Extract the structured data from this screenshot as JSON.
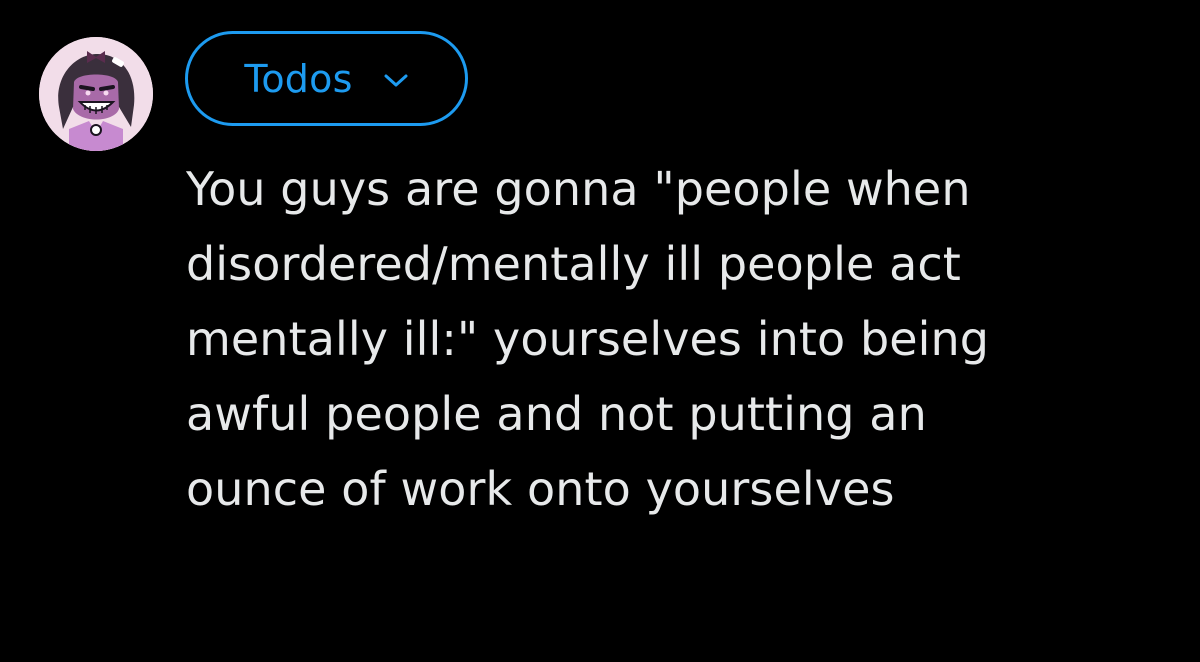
{
  "composer": {
    "avatar": {
      "icon": "avatar-image",
      "description_color": "#f2dde9"
    },
    "audience": {
      "label": "Todos",
      "icon": "chevron-down-icon",
      "color": "#1d9bf0"
    },
    "tweet": {
      "lines": [
        "You guys are gonna \"people when",
        "disordered/mentally ill people act",
        "mentally ill:\" yourselves into being",
        "awful people and not putting an",
        "ounce of work onto yourselves"
      ],
      "text_color": "#e7e9ea"
    }
  },
  "theme": {
    "background": "#000000"
  }
}
